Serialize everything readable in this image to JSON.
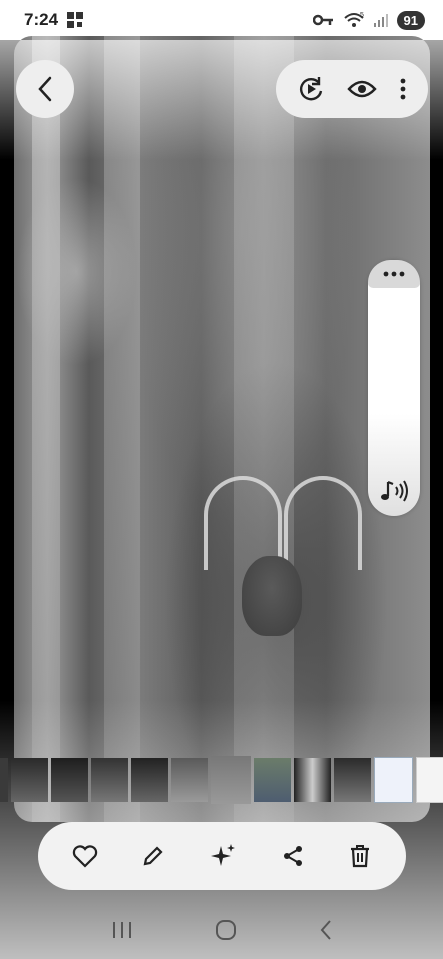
{
  "status_bar": {
    "time": "7:24",
    "signal_badge": "5",
    "battery": "91"
  },
  "photo": {
    "description_icon": "deer-trail-camera-photo"
  },
  "top_actions": [
    "motion-photo-icon",
    "eye-icon",
    "more-vert-icon"
  ],
  "side_panel": {
    "handle_icon": "more-horiz-icon",
    "sound_icon": "sound-icon"
  },
  "thumbnails": [
    {
      "type": "photo",
      "tone": "dark"
    },
    {
      "type": "photo",
      "tone": "dark"
    },
    {
      "type": "photo",
      "tone": "dark"
    },
    {
      "type": "photo",
      "tone": "dark"
    },
    {
      "type": "photo",
      "tone": "dark"
    },
    {
      "type": "photo",
      "tone": "mid"
    },
    {
      "type": "photo",
      "tone": "selected"
    },
    {
      "type": "photo",
      "tone": "color"
    },
    {
      "type": "photo",
      "tone": "dark"
    },
    {
      "type": "photo",
      "tone": "dark"
    },
    {
      "type": "document",
      "tone": "light"
    },
    {
      "type": "document",
      "tone": "light"
    },
    {
      "type": "document",
      "tone": "light"
    }
  ],
  "bottom_bar": [
    "heart-icon",
    "edit-icon",
    "sparkle-icon",
    "share-icon",
    "delete-icon"
  ],
  "nav_bar": [
    "recents-icon",
    "home-icon",
    "back-icon"
  ],
  "colors": {
    "overlay": "#eeeeee",
    "icon": "#222222"
  }
}
